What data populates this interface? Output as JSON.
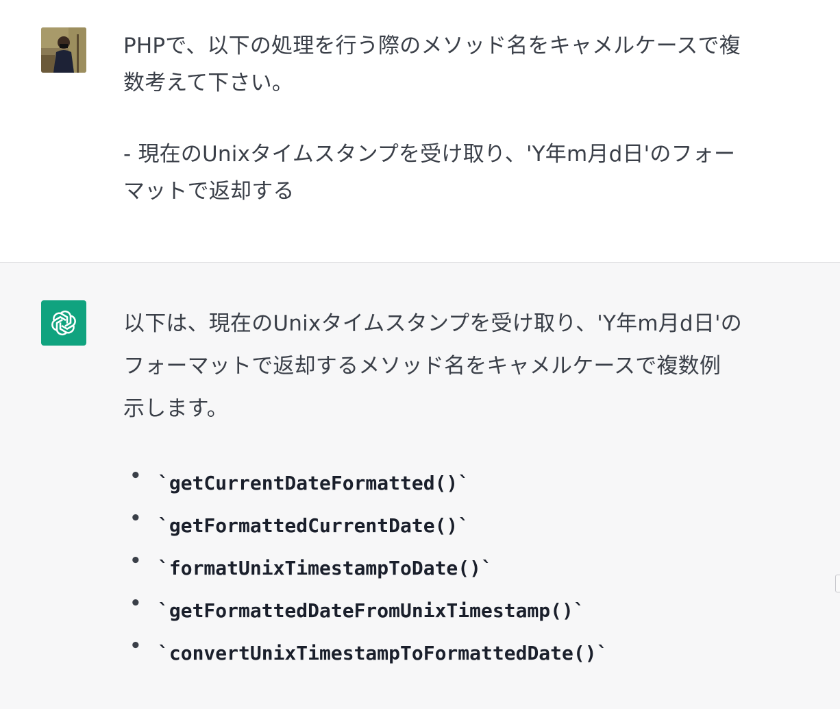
{
  "user_message": {
    "line1": "PHPで、以下の処理を行う際のメソッド名をキャメルケースで複",
    "line2": "数考えて下さい。",
    "line3": "- 現在のUnixタイムスタンプを受け取り、'Y年m月d日'のフォー",
    "line4": "マットで返却する",
    "avatar_icon": "user-photo-icon"
  },
  "assistant_message": {
    "line1": "以下は、現在のUnixタイムスタンプを受け取り、'Y年m月d日'の",
    "line2": "フォーマットで返却するメソッド名をキャメルケースで複数例",
    "line3": "示します。",
    "avatar_icon": "openai-logo-icon",
    "avatar_color": "#10a37f",
    "bullet": "•",
    "methods": [
      "`getCurrentDateFormatted()`",
      "`getFormattedCurrentDate()`",
      "`formatUnixTimestampToDate()`",
      "`getFormattedDateFromUnixTimestamp()`",
      "`convertUnixTimestampToFormattedDate()`"
    ]
  },
  "colors": {
    "user_bg": "#ffffff",
    "assistant_bg": "#f7f7f8",
    "text": "#3a3f48",
    "code_text": "#1a1f2b"
  }
}
